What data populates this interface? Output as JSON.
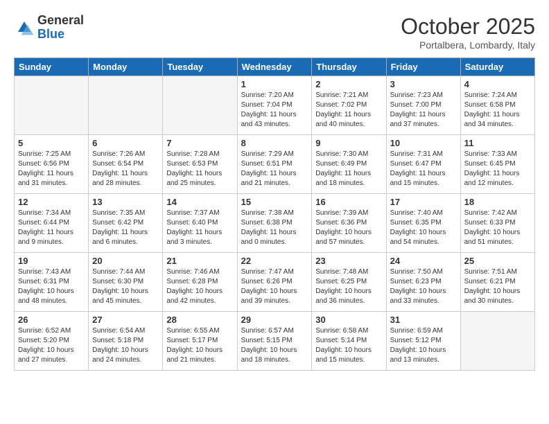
{
  "logo": {
    "general": "General",
    "blue": "Blue"
  },
  "title": "October 2025",
  "location": "Portalbera, Lombardy, Italy",
  "days_of_week": [
    "Sunday",
    "Monday",
    "Tuesday",
    "Wednesday",
    "Thursday",
    "Friday",
    "Saturday"
  ],
  "weeks": [
    [
      {
        "day": "",
        "info": ""
      },
      {
        "day": "",
        "info": ""
      },
      {
        "day": "",
        "info": ""
      },
      {
        "day": "1",
        "info": "Sunrise: 7:20 AM\nSunset: 7:04 PM\nDaylight: 11 hours\nand 43 minutes."
      },
      {
        "day": "2",
        "info": "Sunrise: 7:21 AM\nSunset: 7:02 PM\nDaylight: 11 hours\nand 40 minutes."
      },
      {
        "day": "3",
        "info": "Sunrise: 7:23 AM\nSunset: 7:00 PM\nDaylight: 11 hours\nand 37 minutes."
      },
      {
        "day": "4",
        "info": "Sunrise: 7:24 AM\nSunset: 6:58 PM\nDaylight: 11 hours\nand 34 minutes."
      }
    ],
    [
      {
        "day": "5",
        "info": "Sunrise: 7:25 AM\nSunset: 6:56 PM\nDaylight: 11 hours\nand 31 minutes."
      },
      {
        "day": "6",
        "info": "Sunrise: 7:26 AM\nSunset: 6:54 PM\nDaylight: 11 hours\nand 28 minutes."
      },
      {
        "day": "7",
        "info": "Sunrise: 7:28 AM\nSunset: 6:53 PM\nDaylight: 11 hours\nand 25 minutes."
      },
      {
        "day": "8",
        "info": "Sunrise: 7:29 AM\nSunset: 6:51 PM\nDaylight: 11 hours\nand 21 minutes."
      },
      {
        "day": "9",
        "info": "Sunrise: 7:30 AM\nSunset: 6:49 PM\nDaylight: 11 hours\nand 18 minutes."
      },
      {
        "day": "10",
        "info": "Sunrise: 7:31 AM\nSunset: 6:47 PM\nDaylight: 11 hours\nand 15 minutes."
      },
      {
        "day": "11",
        "info": "Sunrise: 7:33 AM\nSunset: 6:45 PM\nDaylight: 11 hours\nand 12 minutes."
      }
    ],
    [
      {
        "day": "12",
        "info": "Sunrise: 7:34 AM\nSunset: 6:44 PM\nDaylight: 11 hours\nand 9 minutes."
      },
      {
        "day": "13",
        "info": "Sunrise: 7:35 AM\nSunset: 6:42 PM\nDaylight: 11 hours\nand 6 minutes."
      },
      {
        "day": "14",
        "info": "Sunrise: 7:37 AM\nSunset: 6:40 PM\nDaylight: 11 hours\nand 3 minutes."
      },
      {
        "day": "15",
        "info": "Sunrise: 7:38 AM\nSunset: 6:38 PM\nDaylight: 11 hours\nand 0 minutes."
      },
      {
        "day": "16",
        "info": "Sunrise: 7:39 AM\nSunset: 6:36 PM\nDaylight: 10 hours\nand 57 minutes."
      },
      {
        "day": "17",
        "info": "Sunrise: 7:40 AM\nSunset: 6:35 PM\nDaylight: 10 hours\nand 54 minutes."
      },
      {
        "day": "18",
        "info": "Sunrise: 7:42 AM\nSunset: 6:33 PM\nDaylight: 10 hours\nand 51 minutes."
      }
    ],
    [
      {
        "day": "19",
        "info": "Sunrise: 7:43 AM\nSunset: 6:31 PM\nDaylight: 10 hours\nand 48 minutes."
      },
      {
        "day": "20",
        "info": "Sunrise: 7:44 AM\nSunset: 6:30 PM\nDaylight: 10 hours\nand 45 minutes."
      },
      {
        "day": "21",
        "info": "Sunrise: 7:46 AM\nSunset: 6:28 PM\nDaylight: 10 hours\nand 42 minutes."
      },
      {
        "day": "22",
        "info": "Sunrise: 7:47 AM\nSunset: 6:26 PM\nDaylight: 10 hours\nand 39 minutes."
      },
      {
        "day": "23",
        "info": "Sunrise: 7:48 AM\nSunset: 6:25 PM\nDaylight: 10 hours\nand 36 minutes."
      },
      {
        "day": "24",
        "info": "Sunrise: 7:50 AM\nSunset: 6:23 PM\nDaylight: 10 hours\nand 33 minutes."
      },
      {
        "day": "25",
        "info": "Sunrise: 7:51 AM\nSunset: 6:21 PM\nDaylight: 10 hours\nand 30 minutes."
      }
    ],
    [
      {
        "day": "26",
        "info": "Sunrise: 6:52 AM\nSunset: 5:20 PM\nDaylight: 10 hours\nand 27 minutes."
      },
      {
        "day": "27",
        "info": "Sunrise: 6:54 AM\nSunset: 5:18 PM\nDaylight: 10 hours\nand 24 minutes."
      },
      {
        "day": "28",
        "info": "Sunrise: 6:55 AM\nSunset: 5:17 PM\nDaylight: 10 hours\nand 21 minutes."
      },
      {
        "day": "29",
        "info": "Sunrise: 6:57 AM\nSunset: 5:15 PM\nDaylight: 10 hours\nand 18 minutes."
      },
      {
        "day": "30",
        "info": "Sunrise: 6:58 AM\nSunset: 5:14 PM\nDaylight: 10 hours\nand 15 minutes."
      },
      {
        "day": "31",
        "info": "Sunrise: 6:59 AM\nSunset: 5:12 PM\nDaylight: 10 hours\nand 13 minutes."
      },
      {
        "day": "",
        "info": ""
      }
    ]
  ]
}
